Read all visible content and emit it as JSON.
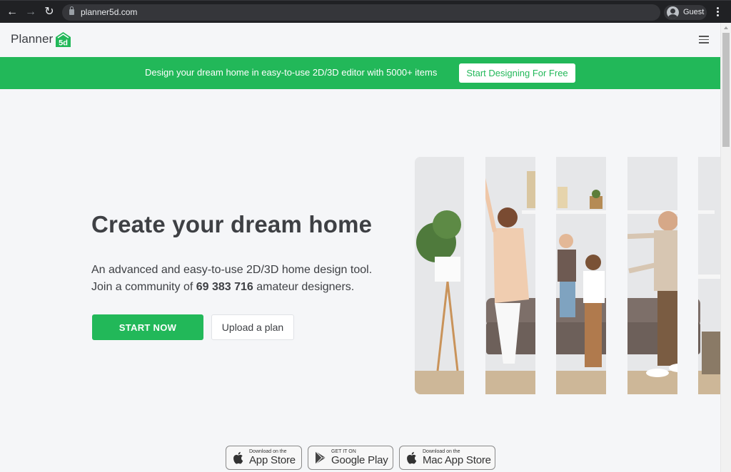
{
  "browser": {
    "url": "planner5d.com",
    "profile_label": "Guest",
    "icons": [
      "back-arrow-icon",
      "forward-arrow-icon",
      "reload-icon",
      "lock-icon",
      "profile-avatar-icon",
      "more-menu-icon"
    ]
  },
  "header": {
    "logo_word": "Planner",
    "logo_badge": "5d",
    "menu_icon": "hamburger-icon"
  },
  "banner": {
    "text": "Design your dream home in easy-to-use 2D/3D editor with 5000+ items",
    "cta_label": "Start Designing For Free"
  },
  "hero": {
    "title": "Create your dream home",
    "subtitle_line1": "An advanced and easy-to-use 2D/3D home design tool.",
    "subtitle_line2_prefix": "Join a community of ",
    "community_count": "69 383 716",
    "subtitle_line2_suffix": " amateur designers.",
    "start_label": "START NOW",
    "upload_label": "Upload a plan",
    "image_description": "Family dancing in a living room, split into five vertical strips"
  },
  "stores": [
    {
      "small": "Download on the",
      "big": "App Store",
      "icon": "apple-icon"
    },
    {
      "small": "GET IT ON",
      "big": "Google Play",
      "icon": "google-play-icon"
    },
    {
      "small": "Download on the",
      "big": "Mac App Store",
      "icon": "apple-icon"
    }
  ],
  "colors": {
    "brand_green": "#22b859",
    "page_bg": "#f5f6f8",
    "text_dark": "#3e4044",
    "chrome_bg": "#202124"
  }
}
